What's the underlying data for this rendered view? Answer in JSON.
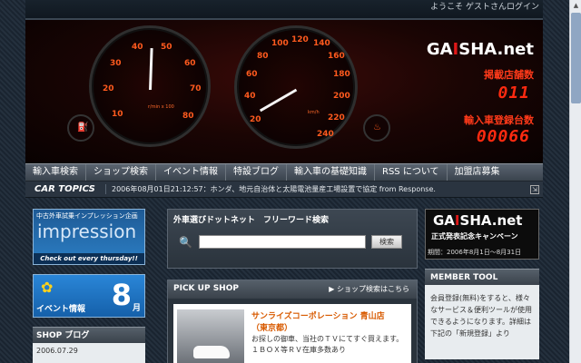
{
  "topbar": {
    "welcome": "ようこそ ゲストさん",
    "login": "ログイン"
  },
  "hero": {
    "logo_a": "GA",
    "logo_i": "I",
    "logo_b": "SHA.net",
    "stores_label": "掲載店舗数",
    "stores_count": "011",
    "cars_label": "輸入車登録台数",
    "cars_count": "00066",
    "tach": {
      "ticks": [
        "10",
        "20",
        "30",
        "40",
        "50",
        "60",
        "70",
        "80"
      ],
      "unit": "r/min x 100"
    },
    "speedo": {
      "ticks": [
        "20",
        "40",
        "60",
        "80",
        "100",
        "120",
        "140",
        "160",
        "180",
        "200",
        "220",
        "240"
      ],
      "unit": "km/h"
    }
  },
  "nav": [
    "輸入車検索",
    "ショップ検索",
    "イベント情報",
    "特設ブログ",
    "輸入車の基礎知識",
    "RSS について",
    "加盟店募集"
  ],
  "topics": {
    "label": "CAR TOPICS",
    "text": "2006年08月01日21:12:57：ホンダ、地元自治体と太陽電池量産工場設置で協定 from Response."
  },
  "left": {
    "impression": {
      "top": "中古外車試乗インプレッション企画",
      "title": "impression",
      "tagline": "Check out every thursday!!"
    },
    "event": {
      "label": "イベント情報",
      "month": "8",
      "unit": "月"
    },
    "blog": {
      "title": "SHOP ブログ",
      "date": "2006.07.29"
    }
  },
  "search": {
    "title": "外車選びドットネット　フリーワード検索",
    "value": "",
    "button": "検索"
  },
  "pickup": {
    "title": "PICK UP SHOP",
    "link": "▶ ショップ検索はこちら",
    "shop": "サンライズコーポレーション 青山店",
    "area": "（東京都）",
    "desc": "お探しの御車、当社のＴＶにてすぐ買えます。１ＢＯＸ等ＲＶ在庫多数あり"
  },
  "right": {
    "banner": {
      "logo_a": "GA",
      "logo_i": "I",
      "logo_b": "SHA.net",
      "sub": "正式発表記念キャンペーン",
      "period": "期間：2006年8月1日～8月31日"
    },
    "member_title": "MEMBER TOOL",
    "member_text": "会員登録(無料)をすると、様々なサービス＆便利ツールが使用できるようになります。詳細は下記の「新規登録」より"
  }
}
